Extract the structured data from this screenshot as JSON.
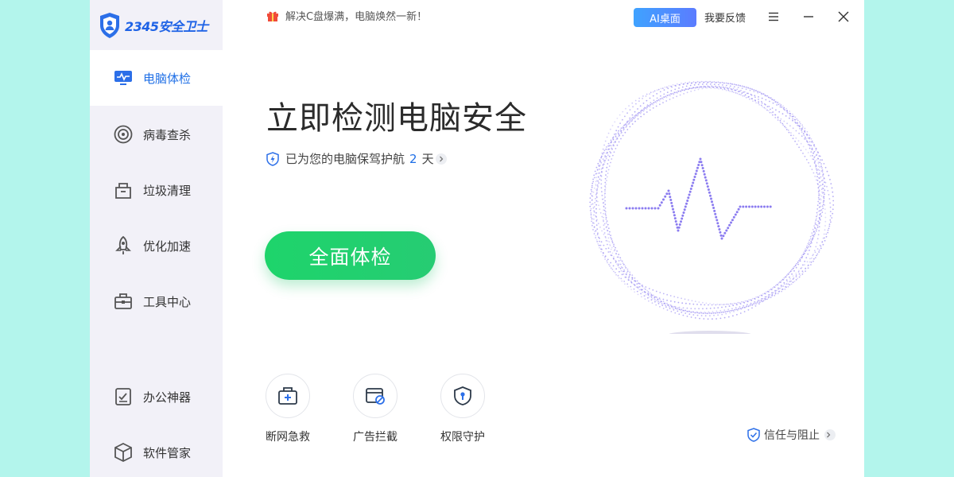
{
  "app": {
    "logo_text": "2345安全卫士"
  },
  "sidebar": {
    "items": [
      {
        "label": "电脑体检",
        "icon": "monitor-pulse-icon",
        "active": true
      },
      {
        "label": "病毒查杀",
        "icon": "target-icon",
        "active": false
      },
      {
        "label": "垃圾清理",
        "icon": "trash-bin-icon",
        "active": false
      },
      {
        "label": "优化加速",
        "icon": "rocket-icon",
        "active": false
      },
      {
        "label": "工具中心",
        "icon": "toolbox-icon",
        "active": false
      },
      {
        "label": "办公神器",
        "icon": "checklist-icon",
        "active": false
      },
      {
        "label": "软件管家",
        "icon": "cube-icon",
        "active": false
      }
    ]
  },
  "topbar": {
    "promo_text": "解决C盘爆满，电脑焕然一新！",
    "ai_button": "AI桌面",
    "feedback": "我要反馈"
  },
  "main": {
    "headline": "立即检测电脑安全",
    "guard_prefix": "已为您的电脑保驾护航",
    "guard_days": "2",
    "guard_suffix": "天",
    "scan_button": "全面体检",
    "tools": [
      {
        "label": "断网急救",
        "icon": "network-rescue-icon"
      },
      {
        "label": "广告拦截",
        "icon": "ad-block-icon"
      },
      {
        "label": "权限守护",
        "icon": "shield-lock-icon"
      }
    ],
    "trust_label": "信任与阻止"
  },
  "colors": {
    "accent_blue": "#1f6fe6",
    "scan_green": "#1ed46b",
    "orb_purple": "#8b7cf0",
    "background": "#b3f5ec"
  }
}
